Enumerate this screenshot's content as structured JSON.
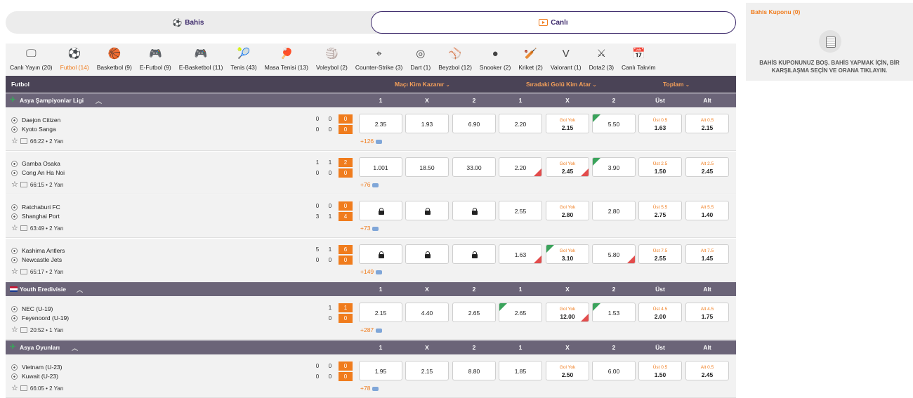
{
  "mode": {
    "bahis": "Bahis",
    "canli": "Canlı"
  },
  "sports": [
    {
      "icon": "tv-icon",
      "glyph": "🖵",
      "label": "Canlı Yayın (20)"
    },
    {
      "icon": "football-icon",
      "glyph": "⚽",
      "label": "Futbol (14)",
      "active": true
    },
    {
      "icon": "basketball-icon",
      "glyph": "🏀",
      "label": "Basketbol (9)"
    },
    {
      "icon": "gamepad-icon",
      "glyph": "🎮",
      "label": "E-Futbol (9)"
    },
    {
      "icon": "gamepad-icon",
      "glyph": "🎮",
      "label": "E-Basketbol (11)"
    },
    {
      "icon": "tennis-icon",
      "glyph": "🎾",
      "label": "Tenis (43)"
    },
    {
      "icon": "table-tennis-icon",
      "glyph": "🏓",
      "label": "Masa Tenisi (13)"
    },
    {
      "icon": "volleyball-icon",
      "glyph": "🏐",
      "label": "Voleybol (2)"
    },
    {
      "icon": "crosshair-icon",
      "glyph": "⌖",
      "label": "Counter-Strike (3)"
    },
    {
      "icon": "dart-icon",
      "glyph": "◎",
      "label": "Dart (1)"
    },
    {
      "icon": "baseball-icon",
      "glyph": "⚾",
      "label": "Beyzbol (12)"
    },
    {
      "icon": "snooker-icon",
      "glyph": "●",
      "label": "Snooker (2)"
    },
    {
      "icon": "cricket-icon",
      "glyph": "🏏",
      "label": "Kriket (2)"
    },
    {
      "icon": "valorant-icon",
      "glyph": "V",
      "label": "Valorant (1)"
    },
    {
      "icon": "dota-icon",
      "glyph": "⚔",
      "label": "Dota2 (3)"
    },
    {
      "icon": "calendar-icon",
      "glyph": "📅",
      "label": "Canlı Takvim"
    }
  ],
  "header": {
    "sport": "Futbol",
    "g1": "Maçı Kim Kazanır",
    "g2": "Sıradaki Golü Kim Atar",
    "g3": "Toplam"
  },
  "leagues": [
    {
      "name": "Asya Şampiyonlar Ligi",
      "cols": [
        "1",
        "X",
        "2",
        "1",
        "X",
        "2",
        "Üst",
        "Alt"
      ],
      "matches": [
        {
          "home": "Daejon Citizen",
          "away": "Kyoto Sanga",
          "hs": [
            "0",
            "0",
            "0"
          ],
          "as": [
            "0",
            "0",
            "0"
          ],
          "time": "66:22 • 2 Yarı",
          "more": "+126",
          "odds": [
            "2.35",
            "1.93",
            "6.90",
            "2.20"
          ],
          "gy": "Gol Yok",
          "gyv": "2.15",
          "o6": "5.50",
          "ust": "Üst 0.5",
          "ustv": "1.63",
          "alt": "Alt 0.5",
          "altv": "2.15",
          "arrows": {
            "6up": true
          }
        },
        {
          "home": "Gamba Osaka",
          "away": "Cong An Ha Noi",
          "hs": [
            "1",
            "1",
            "2"
          ],
          "as": [
            "0",
            "0",
            "0"
          ],
          "time": "66:15 • 2 Yarı",
          "more": "+76",
          "odds": [
            "1.001",
            "18.50",
            "33.00",
            "2.20"
          ],
          "gy": "Gol Yok",
          "gyv": "2.45",
          "o6": "3.90",
          "ust": "Üst 2.5",
          "ustv": "1.50",
          "alt": "Alt 2.5",
          "altv": "2.45",
          "arrows": {
            "4down": true,
            "5down": true,
            "6up": true
          }
        },
        {
          "home": "Ratchaburi FC",
          "away": "Shanghai Port",
          "hs": [
            "0",
            "0",
            "0"
          ],
          "as": [
            "3",
            "1",
            "4"
          ],
          "time": "63:49 • 2 Yarı",
          "more": "+73",
          "odds": [
            "lock",
            "lock",
            "lock",
            "2.55"
          ],
          "gy": "Gol Yok",
          "gyv": "2.80",
          "o6": "2.80",
          "ust": "Üst 5.5",
          "ustv": "2.75",
          "alt": "Alt 5.5",
          "altv": "1.40",
          "arrows": {}
        },
        {
          "home": "Kashima Antlers",
          "away": "Newcastle Jets",
          "hs": [
            "5",
            "1",
            "6"
          ],
          "as": [
            "0",
            "0",
            "0"
          ],
          "time": "65:17 • 2 Yarı",
          "more": "+149",
          "odds": [
            "lock",
            "lock",
            "lock",
            "1.63"
          ],
          "gy": "Gol Yok",
          "gyv": "3.10",
          "o6": "5.80",
          "ust": "Üst 7.5",
          "ustv": "2.55",
          "alt": "Alt 7.5",
          "altv": "1.45",
          "arrows": {
            "4down": true,
            "5up": true,
            "6down": true
          }
        }
      ]
    },
    {
      "name": "Youth Eredivisie",
      "cols": [
        "1",
        "X",
        "2",
        "1",
        "X",
        "2",
        "Üst",
        "Alt"
      ],
      "matches": [
        {
          "home": "NEC (U-19)",
          "away": "Feyenoord (U-19)",
          "hs": [
            "",
            "1",
            "1"
          ],
          "as": [
            "",
            "0",
            "0"
          ],
          "time": "20:52 • 1 Yarı",
          "more": "+287",
          "odds": [
            "2.15",
            "4.40",
            "2.65",
            "2.65"
          ],
          "gy": "Gol Yok",
          "gyv": "12.00",
          "o6": "1.53",
          "ust": "Üst 4.5",
          "ustv": "2.00",
          "alt": "Alt 4.5",
          "altv": "1.75",
          "arrows": {
            "4up": true,
            "5down": true,
            "6up": true
          }
        }
      ]
    },
    {
      "name": "Asya Oyunları",
      "cols": [
        "1",
        "X",
        "2",
        "1",
        "X",
        "2",
        "Üst",
        "Alt"
      ],
      "matches": [
        {
          "home": "Vietnam (U-23)",
          "away": "Kuwait (U-23)",
          "hs": [
            "0",
            "0",
            "0"
          ],
          "as": [
            "0",
            "0",
            "0"
          ],
          "time": "66:05 • 2 Yarı",
          "more": "+78",
          "odds": [
            "1.95",
            "2.15",
            "8.80",
            "1.85"
          ],
          "gy": "Gol Yok",
          "gyv": "2.50",
          "o6": "6.00",
          "ust": "Üst 0.5",
          "ustv": "1.50",
          "alt": "Alt 0.5",
          "altv": "2.45",
          "arrows": {}
        }
      ]
    }
  ],
  "coupon": {
    "title": "Bahis Kuponu (0)",
    "message": "BAHİS KUPONUNUZ BOŞ. BAHİS YAPMAK İÇİN, BİR KARŞILAŞMA SEÇİN VE ORANA TIKLAYIN."
  },
  "colors": {
    "accent": "#f07c1d",
    "header": "#4a4356",
    "league": "#6b6478",
    "up": "#3aa35b",
    "down": "#e34c4c"
  }
}
